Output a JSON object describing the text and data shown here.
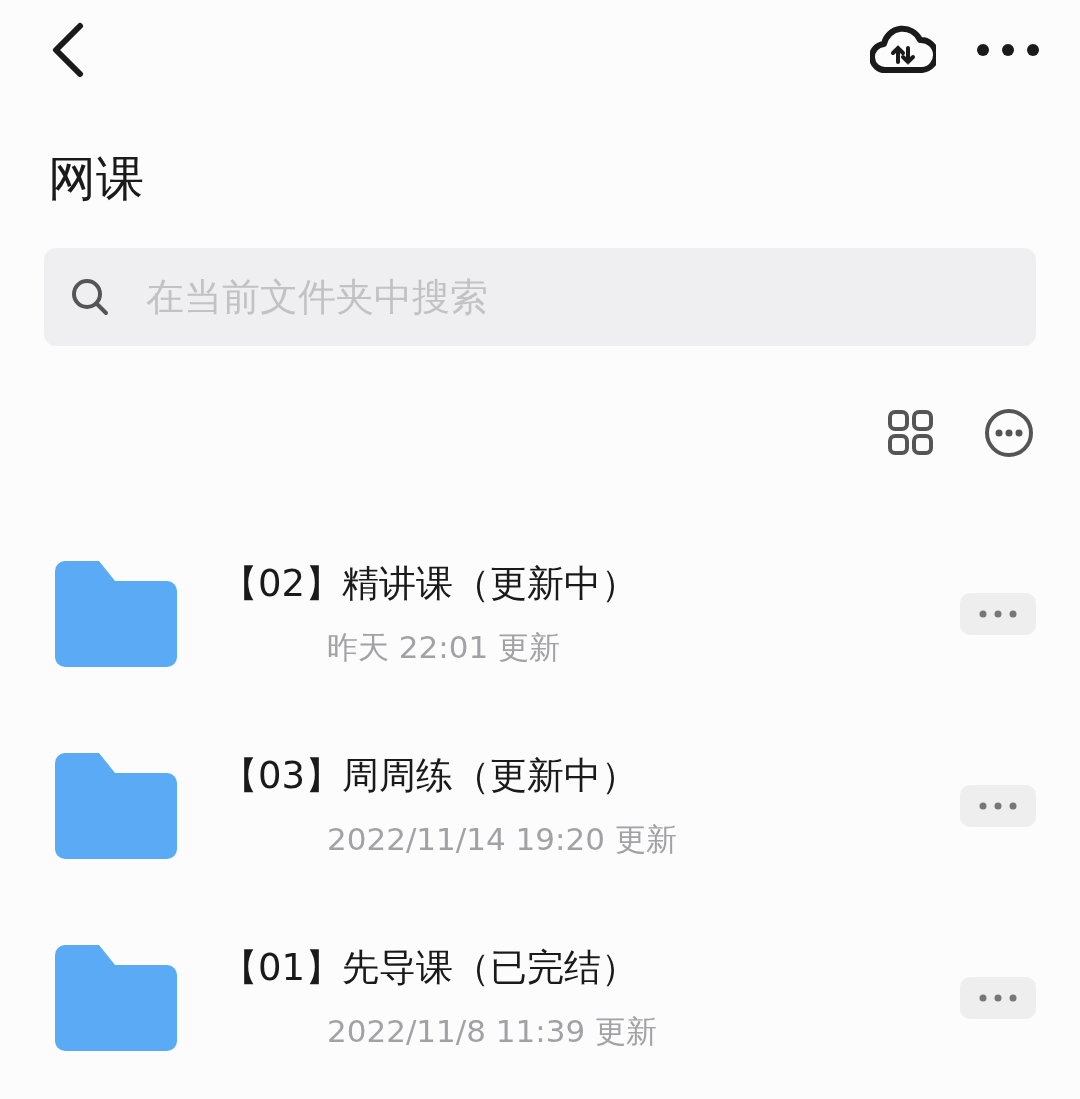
{
  "header": {
    "title": "网课"
  },
  "search": {
    "placeholder": "在当前文件夹中搜索"
  },
  "files": [
    {
      "name": "【02】精讲课（更新中）",
      "updated": "昨天 22:01 更新"
    },
    {
      "name": "【03】周周练（更新中）",
      "updated": "2022/11/14 19:20 更新"
    },
    {
      "name": "【01】先导课（已完结）",
      "updated": "2022/11/8 11:39 更新"
    }
  ]
}
